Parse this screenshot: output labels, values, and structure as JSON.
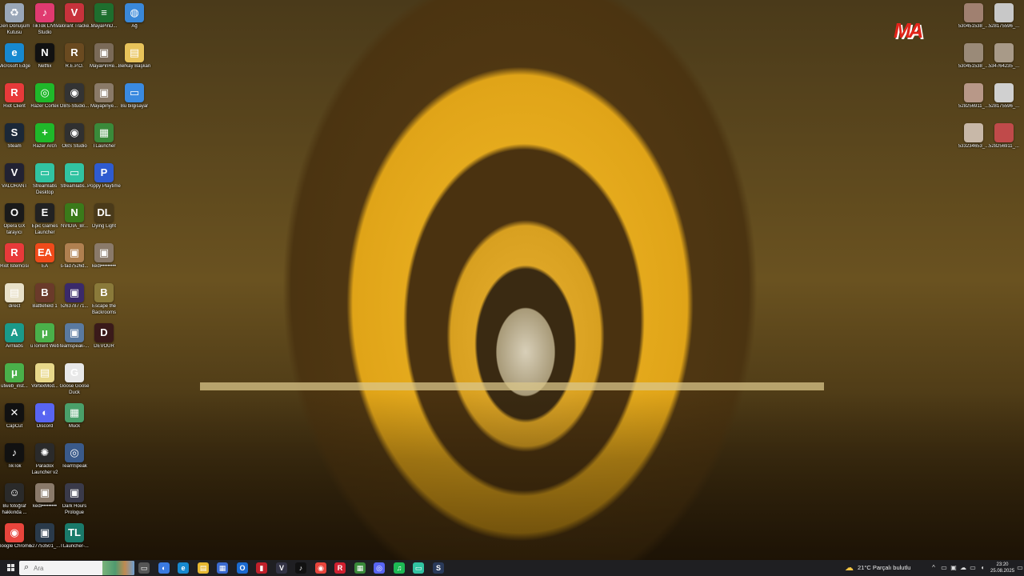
{
  "desktop_icons": [
    {
      "id": "geri",
      "label": "Geri Dönüşüm Kutusu",
      "col": 0,
      "row": 0,
      "color": "#9aa7b8",
      "glyph": "♻"
    },
    {
      "id": "tiktoklive",
      "label": "TikTok LIVE Studio",
      "col": 1,
      "row": 0,
      "color": "#e03a70",
      "glyph": "♪"
    },
    {
      "id": "valorant-tracker",
      "label": "Valorant Tracke...",
      "col": 2,
      "row": 0,
      "color": "#c8323c",
      "glyph": "V"
    },
    {
      "id": "mayapin",
      "label": "MayaPinD...",
      "col": 3,
      "row": 0,
      "color": "#1e6e2e",
      "glyph": "≡"
    },
    {
      "id": "ag",
      "label": "Ağ",
      "col": 4,
      "row": 0,
      "color": "#3a88d8",
      "glyph": "◍"
    },
    {
      "id": "edge",
      "label": "Microsoft Edge",
      "col": 0,
      "row": 1,
      "color": "#1789d0",
      "glyph": "e"
    },
    {
      "id": "netflix",
      "label": "Netflix",
      "col": 1,
      "row": 1,
      "color": "#111111",
      "glyph": "N"
    },
    {
      "id": "repo",
      "label": "R.E.P.O.",
      "col": 2,
      "row": 1,
      "color": "#6a4a20",
      "glyph": "R"
    },
    {
      "id": "mayapinre",
      "label": "MayaPinRe...",
      "col": 3,
      "row": 1,
      "color": "#7a6a58",
      "glyph": "▣"
    },
    {
      "id": "berkay",
      "label": "Berkay Başkan",
      "col": 4,
      "row": 1,
      "color": "#e8c35a",
      "glyph": "▤"
    },
    {
      "id": "riot",
      "label": "Riot Client",
      "col": 0,
      "row": 2,
      "color": "#e83a3a",
      "glyph": "R"
    },
    {
      "id": "razer-cortex",
      "label": "Razer Cortex",
      "col": 1,
      "row": 2,
      "color": "#1fb82a",
      "glyph": "◎"
    },
    {
      "id": "obs-studio2",
      "label": "OBS-Studio...",
      "col": 2,
      "row": 2,
      "color": "#333333",
      "glyph": "◉"
    },
    {
      "id": "mayapinye",
      "label": "Mayapinye...",
      "col": 3,
      "row": 2,
      "color": "#8a7a68",
      "glyph": "▣"
    },
    {
      "id": "bu-bilgisayar",
      "label": "Bu bilgisayar",
      "col": 4,
      "row": 2,
      "color": "#3a8ae0",
      "glyph": "▭"
    },
    {
      "id": "steam",
      "label": "Steam",
      "col": 0,
      "row": 3,
      "color": "#1b2838",
      "glyph": "S"
    },
    {
      "id": "razer-arcn",
      "label": "Razer Arcn",
      "col": 1,
      "row": 3,
      "color": "#1fb82a",
      "glyph": "+"
    },
    {
      "id": "obs-studio",
      "label": "OBS Studio",
      "col": 2,
      "row": 3,
      "color": "#303030",
      "glyph": "◉"
    },
    {
      "id": "tlauncher",
      "label": "TLauncher",
      "col": 3,
      "row": 3,
      "color": "#3a8a3a",
      "glyph": "▦"
    },
    {
      "id": "valorant",
      "label": "VALORANT",
      "col": 0,
      "row": 4,
      "color": "#222233",
      "glyph": "V"
    },
    {
      "id": "streamlabs-desktop",
      "label": "Streamlabs Desktop",
      "col": 1,
      "row": 4,
      "color": "#31c3a2",
      "glyph": "▭"
    },
    {
      "id": "streamlabs",
      "label": "Streamlabs...",
      "col": 2,
      "row": 4,
      "color": "#31c3a2",
      "glyph": "▭"
    },
    {
      "id": "poppy",
      "label": "Poppy Playtime",
      "col": 3,
      "row": 4,
      "color": "#2f5bd0",
      "glyph": "P"
    },
    {
      "id": "opera-gx",
      "label": "Opera GX tarayıcı",
      "col": 0,
      "row": 5,
      "color": "#1a1a1a",
      "glyph": "O"
    },
    {
      "id": "epic",
      "label": "Epic Games Launcher",
      "col": 1,
      "row": 5,
      "color": "#222222",
      "glyph": "E"
    },
    {
      "id": "nvidia",
      "label": "NVIDIA_Br...",
      "col": 2,
      "row": 5,
      "color": "#3a7a1a",
      "glyph": "N"
    },
    {
      "id": "dying-light",
      "label": "Dying Light",
      "col": 3,
      "row": 5,
      "color": "#4a3a1a",
      "glyph": "DL"
    },
    {
      "id": "riot-istemci",
      "label": "Riot İstemcisi",
      "col": 0,
      "row": 6,
      "color": "#e83a3a",
      "glyph": "R"
    },
    {
      "id": "ea",
      "label": "EA",
      "col": 1,
      "row": 6,
      "color": "#f04a1a",
      "glyph": "EA"
    },
    {
      "id": "s-fad",
      "label": "s-fad7526d...",
      "col": 2,
      "row": 6,
      "color": "#b08050",
      "glyph": "▣"
    },
    {
      "id": "kedi1",
      "label": "kedi•••••••••",
      "col": 3,
      "row": 6,
      "color": "#8a7a6a",
      "glyph": "▣"
    },
    {
      "id": "direct",
      "label": "direct",
      "col": 0,
      "row": 7,
      "color": "#e8e0c8",
      "glyph": "▤"
    },
    {
      "id": "battlefield",
      "label": "Battlefield 1",
      "col": 1,
      "row": 7,
      "color": "#6a3a2a",
      "glyph": "B"
    },
    {
      "id": "526378771",
      "label": "526378771...",
      "col": 2,
      "row": 7,
      "color": "#3a2a6a",
      "glyph": "▣"
    },
    {
      "id": "escape-backrooms",
      "label": "Escape the Backrooms",
      "col": 3,
      "row": 7,
      "color": "#8a7a3a",
      "glyph": "B"
    },
    {
      "id": "airnlabs",
      "label": "Airnlabs",
      "col": 0,
      "row": 8,
      "color": "#1a9a8a",
      "glyph": "A"
    },
    {
      "id": "utorrent-web",
      "label": "uTorrent Web",
      "col": 1,
      "row": 8,
      "color": "#4ab04a",
      "glyph": "μ"
    },
    {
      "id": "teamspeak-dl",
      "label": "teamspeak-...",
      "col": 2,
      "row": 8,
      "color": "#5a7aa0",
      "glyph": "▣"
    },
    {
      "id": "devour",
      "label": "DEVOUR",
      "col": 3,
      "row": 8,
      "color": "#3a1a1a",
      "glyph": "D"
    },
    {
      "id": "utweb-inst",
      "label": "utweb_inst...",
      "col": 0,
      "row": 9,
      "color": "#4ab04a",
      "glyph": "μ"
    },
    {
      "id": "vortex",
      "label": "VortexMod...",
      "col": 1,
      "row": 9,
      "color": "#e8d88a",
      "glyph": "▤"
    },
    {
      "id": "goose",
      "label": "Goose Goose Duck",
      "col": 2,
      "row": 9,
      "color": "#e8e8e8",
      "glyph": "G"
    },
    {
      "id": "capcut",
      "label": "CapCut",
      "col": 0,
      "row": 10,
      "color": "#111111",
      "glyph": "✕"
    },
    {
      "id": "discord",
      "label": "Discord",
      "col": 1,
      "row": 10,
      "color": "#5865f2",
      "glyph": "◐"
    },
    {
      "id": "muck",
      "label": "Muck",
      "col": 2,
      "row": 10,
      "color": "#4aa06a",
      "glyph": "▦"
    },
    {
      "id": "tiktok",
      "label": "TikTok",
      "col": 0,
      "row": 11,
      "color": "#111111",
      "glyph": "♪"
    },
    {
      "id": "paradox",
      "label": "Paradox Launcher v2",
      "col": 1,
      "row": 11,
      "color": "#2a2a2a",
      "glyph": "✺"
    },
    {
      "id": "teamspeak",
      "label": "TeamSpeak",
      "col": 2,
      "row": 11,
      "color": "#3a5a8a",
      "glyph": "◎"
    },
    {
      "id": "fotograf",
      "label": "Bu fotoğraf hakkında ...",
      "col": 0,
      "row": 12,
      "color": "#2a2a2a",
      "glyph": "☺"
    },
    {
      "id": "kedi2",
      "label": "kedi•••••••••",
      "col": 1,
      "row": 12,
      "color": "#8a7a6a",
      "glyph": "▣"
    },
    {
      "id": "dark-hours",
      "label": "Dark Hours Prologue",
      "col": 2,
      "row": 12,
      "color": "#3a3a4a",
      "glyph": "▣"
    },
    {
      "id": "chrome",
      "label": "Google Chrome",
      "col": 0,
      "row": 13,
      "color": "#e8453c",
      "glyph": "◉"
    },
    {
      "id": "527753501",
      "label": "527753501_...",
      "col": 1,
      "row": 13,
      "color": "#2a3a4a",
      "glyph": "▣"
    },
    {
      "id": "tlauncher2",
      "label": "TLauncher-...",
      "col": 2,
      "row": 13,
      "color": "#1a7a6a",
      "glyph": "TL"
    }
  ],
  "right_icons": [
    {
      "id": "r1",
      "label": "530451538_...",
      "col": 0,
      "row": 0,
      "color": "#a08070"
    },
    {
      "id": "r2",
      "label": "528175596_...",
      "col": 1,
      "row": 0,
      "color": "#c8c8c8"
    },
    {
      "id": "r3",
      "label": "530451538_...",
      "col": 0,
      "row": 1,
      "color": "#9a8a78"
    },
    {
      "id": "r4",
      "label": "534764235_...",
      "col": 1,
      "row": 1,
      "color": "#a89a88"
    },
    {
      "id": "r5",
      "label": "528256911_...",
      "col": 0,
      "row": 2,
      "color": "#b89888"
    },
    {
      "id": "r6",
      "label": "528175596_...",
      "col": 1,
      "row": 2,
      "color": "#d0d0d0"
    },
    {
      "id": "r7",
      "label": "533234653_...",
      "col": 0,
      "row": 3,
      "color": "#c8b8a8"
    },
    {
      "id": "r8",
      "label": "528256911_...",
      "col": 1,
      "row": 3,
      "color": "#c04a4a"
    }
  ],
  "logo_text": "MA",
  "taskbar": {
    "search_placeholder": "Ara",
    "apps": [
      {
        "id": "task-view",
        "glyph": "▭",
        "color": "#555555"
      },
      {
        "id": "copilot",
        "glyph": "◐",
        "color": "#3a7ae0"
      },
      {
        "id": "edge",
        "glyph": "e",
        "color": "#1789d0"
      },
      {
        "id": "explorer",
        "glyph": "▤",
        "color": "#e8b830"
      },
      {
        "id": "store",
        "glyph": "▦",
        "color": "#3a6ad0"
      },
      {
        "id": "outlook",
        "glyph": "O",
        "color": "#1a6ad0"
      },
      {
        "id": "red-app",
        "glyph": "▮",
        "color": "#c0202a"
      },
      {
        "id": "valorant",
        "glyph": "V",
        "color": "#333344"
      },
      {
        "id": "tiktok",
        "glyph": "♪",
        "color": "#111111"
      },
      {
        "id": "chrome",
        "glyph": "◉",
        "color": "#e8453c"
      },
      {
        "id": "riot",
        "glyph": "R",
        "color": "#d02030"
      },
      {
        "id": "minecraft",
        "glyph": "▦",
        "color": "#3a8a3a"
      },
      {
        "id": "discord-like",
        "glyph": "◎",
        "color": "#5865f2"
      },
      {
        "id": "spotify",
        "glyph": "♫",
        "color": "#1db954"
      },
      {
        "id": "streamlabs",
        "glyph": "▭",
        "color": "#31c3a2"
      },
      {
        "id": "steam",
        "glyph": "S",
        "color": "#2a3a5a"
      }
    ],
    "weather_text": "21°C  Parçalı bulutlu",
    "time": "23:20",
    "date": "25.08.2025"
  }
}
